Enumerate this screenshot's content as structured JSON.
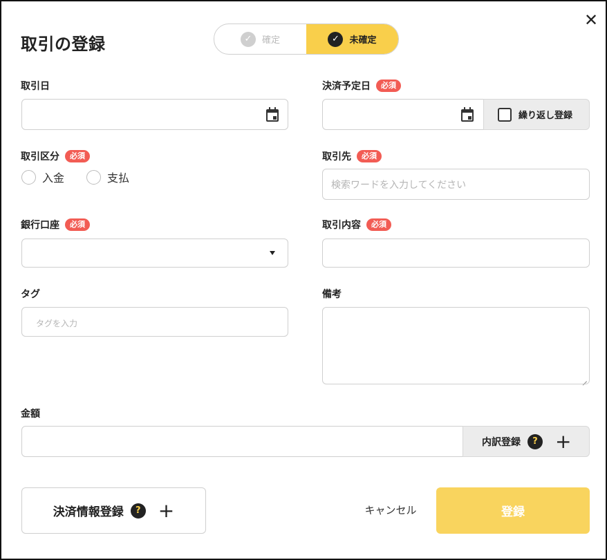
{
  "dialog": {
    "title": "取引の登録",
    "close_symbol": "✕"
  },
  "status_toggle": {
    "confirmed_label": "確定",
    "unconfirmed_label": "未確定",
    "selected": "未確定",
    "check_symbol": "✓"
  },
  "required_badge": "必須",
  "fields": {
    "transaction_date": {
      "label": "取引日",
      "value": ""
    },
    "payment_due_date": {
      "label": "決済予定日",
      "value": ""
    },
    "repeat_register": {
      "label": "繰り返し登録",
      "checked": false
    },
    "transaction_type": {
      "label": "取引区分",
      "options": [
        "入金",
        "支払"
      ],
      "selected": null
    },
    "partner": {
      "label": "取引先",
      "placeholder": "検索ワードを入力してください",
      "value": ""
    },
    "bank_account": {
      "label": "銀行口座",
      "value": ""
    },
    "description": {
      "label": "取引内容",
      "value": ""
    },
    "tags": {
      "label": "タグ",
      "placeholder": "タグを入力",
      "value": ""
    },
    "notes": {
      "label": "備考",
      "value": ""
    },
    "amount": {
      "label": "金額",
      "value": ""
    }
  },
  "breakdown_button": {
    "label": "内訳登録",
    "help_symbol": "?",
    "plus_symbol": "+"
  },
  "payment_info_button": {
    "label": "決済情報登録",
    "help_symbol": "?",
    "plus_symbol": "+"
  },
  "cancel_label": "キャンセル",
  "submit_label": "登録",
  "colors": {
    "accent": "#f9cf4b",
    "submit_disabled": "#f9d45e",
    "required_badge": "#f25c54",
    "border": "#cfcfcf"
  },
  "icons": [
    "close-icon",
    "check-icon",
    "calendar-icon",
    "checkbox-icon",
    "radio-icon",
    "chevron-down-icon",
    "help-icon",
    "plus-icon"
  ]
}
